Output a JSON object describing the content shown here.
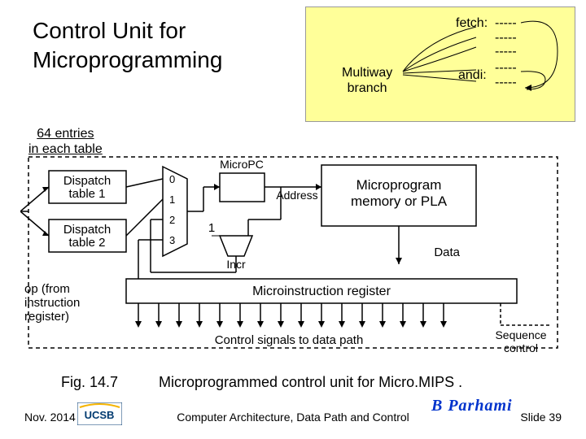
{
  "title_l1": "Control Unit for",
  "title_l2": "Microprogramming",
  "multiway_l1": "Multiway",
  "multiway_l2": "branch",
  "fetch_label": "fetch:",
  "fetch_dashes": "-----\n-----\n-----",
  "andi_label": "andi:",
  "andi_dashes": "-----\n-----",
  "entries_l1": "64 entries",
  "entries_l2": "in each table",
  "fig_num": "Fig. 14.7",
  "fig_caption": "Microprogrammed control unit for Micro.MIPS .",
  "footer_date": "Nov. 2014",
  "footer_center": "Computer Architecture, Data Path and Control",
  "footer_slide": "Slide 39",
  "logo_text": "UCSB",
  "author": "B Parhami",
  "diagram": {
    "dispatch1": "Dispatch\ntable 1",
    "dispatch2": "Dispatch\ntable 2",
    "mux_in": [
      "0",
      "1",
      "2",
      "3"
    ],
    "one": "1",
    "micropc": "MicroPC",
    "incr": "Incr",
    "address": "Address",
    "mem": "Microprogram\nmemory or PLA",
    "data": "Data",
    "mir": "Microinstruction register",
    "op": "op (from\ninstruction\nregister)",
    "csig": "Control signals to data path",
    "seq": "Sequence\ncontrol"
  }
}
